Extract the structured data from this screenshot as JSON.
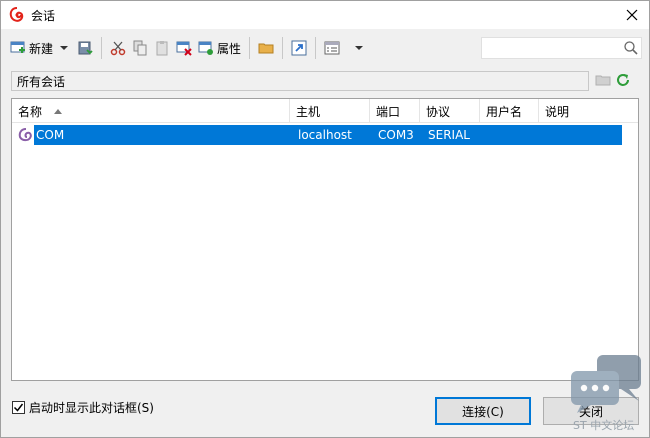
{
  "window": {
    "title": "会话"
  },
  "toolbar": {
    "new_label": "新建",
    "properties_label": "属性"
  },
  "search": {
    "placeholder": ""
  },
  "pathbar": {
    "text": "所有会话"
  },
  "table": {
    "columns": [
      "名称",
      "主机",
      "端口",
      "协议",
      "用户名",
      "说明"
    ],
    "rows": [
      {
        "name": "COM",
        "host": "localhost",
        "port": "COM3",
        "protocol": "SERIAL",
        "username": "",
        "description": ""
      }
    ]
  },
  "footer": {
    "startup_checkbox_label": "启动时显示此对话框(S)",
    "startup_checked": true,
    "connect_label": "连接(C)",
    "close_label": "关闭"
  },
  "watermark": {
    "text": "ST 中文论坛"
  },
  "colors": {
    "selection": "#0078d7",
    "accent": "#0078d7"
  }
}
